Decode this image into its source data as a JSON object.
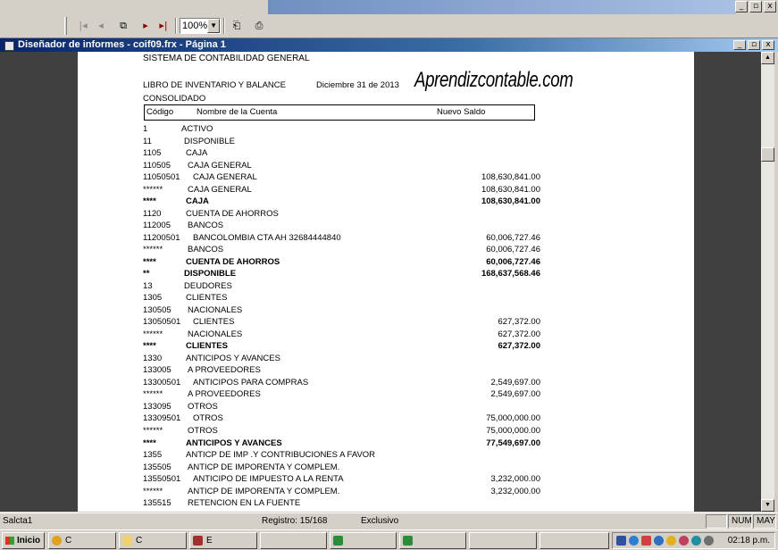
{
  "toolbar": {
    "zoom_value": "100%",
    "buttons": [
      "first-page",
      "previous-page",
      "go-to-page",
      "next-page",
      "last-page",
      "close-preview",
      "print"
    ]
  },
  "window": {
    "title": "Diseñador de informes - coif09.frx - Página 1",
    "controls": [
      "_",
      "▫",
      "x"
    ]
  },
  "report": {
    "system_title": "SISTEMA DE CONTABILIDAD GENERAL",
    "book_title": "LIBRO DE INVENTARIO Y BALANCE",
    "date": "Diciembre 31 de 2013",
    "brand": "Aprendizcontable.com",
    "scope": "CONSOLIDADO",
    "columns": {
      "code": "Código",
      "name": "Nombre de la Cuenta",
      "balance": "Nuevo Saldo"
    },
    "rows": [
      {
        "code": "1",
        "name": "ACTIVO",
        "amount": "",
        "bold": false,
        "indent": 1
      },
      {
        "code": "11",
        "name": "DISPONIBLE",
        "amount": "",
        "bold": false,
        "indent": 2
      },
      {
        "code": "1105",
        "name": "CAJA",
        "amount": "",
        "bold": false,
        "indent": 3
      },
      {
        "code": "110505",
        "name": "CAJA GENERAL",
        "amount": "",
        "bold": false,
        "indent": 4
      },
      {
        "code": "11050501",
        "name": "CAJA GENERAL",
        "amount": "108,630,841.00",
        "bold": false,
        "indent": 0
      },
      {
        "code": "******",
        "name": "CAJA GENERAL",
        "amount": "108,630,841.00",
        "bold": false,
        "indent": 4
      },
      {
        "code": "****",
        "name": "CAJA",
        "amount": "108,630,841.00",
        "bold": true,
        "indent": 3
      },
      {
        "code": "1120",
        "name": "CUENTA DE AHORROS",
        "amount": "",
        "bold": false,
        "indent": 3
      },
      {
        "code": "112005",
        "name": "BANCOS",
        "amount": "",
        "bold": false,
        "indent": 4
      },
      {
        "code": "11200501",
        "name": "BANCOLOMBIA CTA AH 32684444840",
        "amount": "60,006,727.46",
        "bold": false,
        "indent": 0
      },
      {
        "code": "******",
        "name": "BANCOS",
        "amount": "60,006,727.46",
        "bold": false,
        "indent": 4
      },
      {
        "code": "****",
        "name": "CUENTA DE AHORROS",
        "amount": "60,006,727.46",
        "bold": true,
        "indent": 3
      },
      {
        "code": "**",
        "name": "DISPONIBLE",
        "amount": "168,637,568.46",
        "bold": true,
        "indent": 2
      },
      {
        "code": "13",
        "name": "DEUDORES",
        "amount": "",
        "bold": false,
        "indent": 2
      },
      {
        "code": "1305",
        "name": "CLIENTES",
        "amount": "",
        "bold": false,
        "indent": 3
      },
      {
        "code": "130505",
        "name": "NACIONALES",
        "amount": "",
        "bold": false,
        "indent": 4
      },
      {
        "code": "13050501",
        "name": "CLIENTES",
        "amount": "627,372.00",
        "bold": false,
        "indent": 0
      },
      {
        "code": "******",
        "name": "NACIONALES",
        "amount": "627,372.00",
        "bold": false,
        "indent": 4
      },
      {
        "code": "****",
        "name": "CLIENTES",
        "amount": "627,372.00",
        "bold": true,
        "indent": 3
      },
      {
        "code": "1330",
        "name": "ANTICIPOS Y AVANCES",
        "amount": "",
        "bold": false,
        "indent": 3
      },
      {
        "code": "133005",
        "name": "A PROVEEDORES",
        "amount": "",
        "bold": false,
        "indent": 4
      },
      {
        "code": "13300501",
        "name": "ANTICIPOS PARA COMPRAS",
        "amount": "2,549,697.00",
        "bold": false,
        "indent": 0
      },
      {
        "code": "******",
        "name": "A PROVEEDORES",
        "amount": "2,549,697.00",
        "bold": false,
        "indent": 4
      },
      {
        "code": "133095",
        "name": "OTROS",
        "amount": "",
        "bold": false,
        "indent": 4
      },
      {
        "code": "13309501",
        "name": "OTROS",
        "amount": "75,000,000.00",
        "bold": false,
        "indent": 0
      },
      {
        "code": "******",
        "name": "OTROS",
        "amount": "75,000,000.00",
        "bold": false,
        "indent": 4
      },
      {
        "code": "****",
        "name": "ANTICIPOS Y AVANCES",
        "amount": "77,549,697.00",
        "bold": true,
        "indent": 3
      },
      {
        "code": "1355",
        "name": "ANTICP DE IMP .Y CONTRIBUCIONES A FAVOR",
        "amount": "",
        "bold": false,
        "indent": 3
      },
      {
        "code": "135505",
        "name": "ANTICP DE IMPORENTA Y COMPLEM.",
        "amount": "",
        "bold": false,
        "indent": 4
      },
      {
        "code": "13550501",
        "name": "ANTICIPO DE IMPUESTO A LA RENTA",
        "amount": "3,232,000.00",
        "bold": false,
        "indent": 0
      },
      {
        "code": "******",
        "name": "ANTICP DE IMPORENTA Y COMPLEM.",
        "amount": "3,232,000.00",
        "bold": false,
        "indent": 4
      },
      {
        "code": "135515",
        "name": "RETENCION EN LA FUENTE",
        "amount": "",
        "bold": false,
        "indent": 4
      }
    ]
  },
  "status": {
    "table": "Salcta1",
    "record": "Registro: 15/168",
    "mode": "Exclusivo",
    "num": "NUM",
    "caps": "MAY"
  },
  "taskbar": {
    "start_label": "Inicio",
    "tasks": [
      "C",
      "C",
      "E",
      "",
      "",
      "",
      "",
      "",
      "",
      ""
    ],
    "clock": "02:18 p.m."
  },
  "colors": {
    "title_gradient_start": "#0a246a",
    "title_gradient_end": "#a6caf0",
    "preview_background": "#404040",
    "chrome": "#d4d0c8"
  }
}
